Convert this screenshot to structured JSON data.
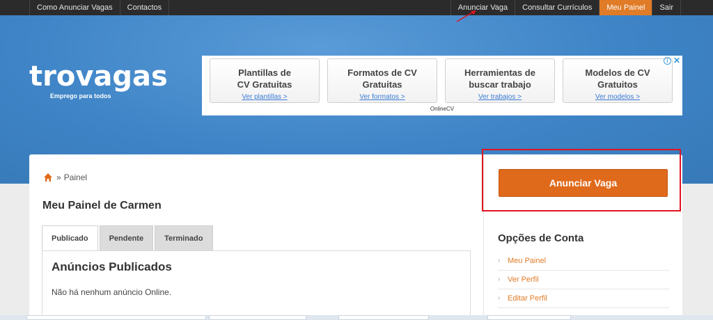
{
  "topnav": {
    "left": [
      "Como Anunciar Vagas",
      "Contactos"
    ],
    "right": [
      "Anunciar Vaga",
      "Consultar Currículos",
      "Meu Painel",
      "Sair"
    ],
    "active": "Meu Painel"
  },
  "logo": {
    "word": "trovagas",
    "tagline": "Emprego para todos"
  },
  "ad": {
    "items": [
      {
        "title_l1": "Plantillas de",
        "title_l2": "CV Gratuitas",
        "link": "Ver plantillas >"
      },
      {
        "title_l1": "Formatos de CV",
        "title_l2": "Gratuitas",
        "link": "Ver formatos >"
      },
      {
        "title_l1": "Herramientas de",
        "title_l2": "buscar trabajo",
        "link": "Ver trabajos >"
      },
      {
        "title_l1": "Modelos de CV",
        "title_l2": "Gratuitos",
        "link": "Ver modelos >"
      }
    ],
    "footer": "OnlineCV",
    "info": "i",
    "close": "✕"
  },
  "breadcrumb": {
    "sep": "»",
    "current": "Painel"
  },
  "page_title": "Meu Painel de Carmen",
  "tabs": [
    "Publicado",
    "Pendente",
    "Terminado"
  ],
  "panel": {
    "title": "Anúncios Publicados",
    "empty": "Não há nenhum anúncio Online."
  },
  "cta": {
    "label": "Anunciar Vaga"
  },
  "account": {
    "title": "Opções de Conta",
    "items": [
      "Meu Painel",
      "Ver Perfil",
      "Editar Perfil"
    ]
  },
  "colors": {
    "accent": "#e07b27",
    "hero": "#3e84c6",
    "highlight": "#e0131f"
  }
}
